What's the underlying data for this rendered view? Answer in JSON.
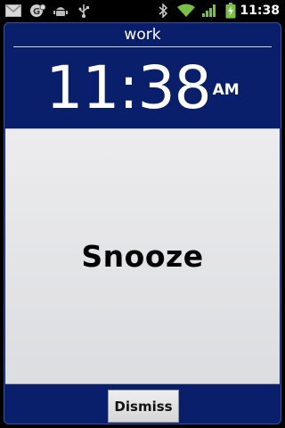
{
  "status_bar": {
    "time": "11:38",
    "icons": [
      "gmail-icon",
      "notification-icon",
      "android-debug-icon",
      "usb-icon",
      "bluetooth-icon",
      "wifi-icon",
      "signal-icon",
      "battery-charging-icon"
    ]
  },
  "alarm": {
    "label": "work",
    "time": "11:38",
    "ampm": "AM"
  },
  "buttons": {
    "snooze": "Snooze",
    "dismiss": "Dismiss"
  },
  "colors": {
    "dialog_background": "#0a1f6b",
    "battery_green": "#7ac143",
    "wifi_green": "#7ac143"
  }
}
